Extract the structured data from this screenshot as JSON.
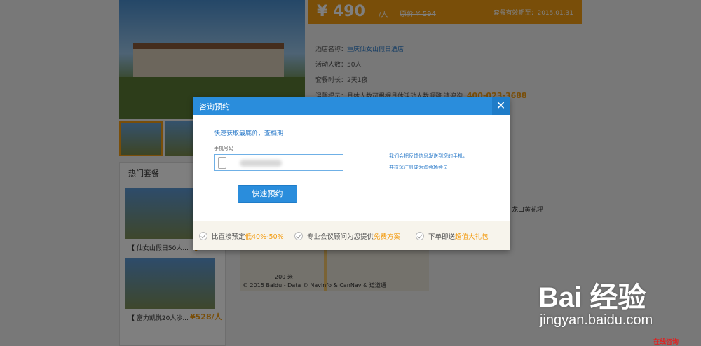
{
  "background_page": {
    "price": "¥ 490",
    "price_unit": "/人",
    "price_old": "原价 ¥ 594",
    "deadline": "套餐有效期至：2015.01.31",
    "info": [
      {
        "label": "酒店名称：",
        "value": "重庆仙女山假日酒店"
      },
      {
        "label": "活动人数：",
        "value": "50人"
      },
      {
        "label": "套餐时长：",
        "value": "2天1夜"
      },
      {
        "label": "温馨提示：",
        "value": "具体人数可根据具体活动人数调整,请咨询",
        "phone": "400-023-3688"
      }
    ],
    "hot_title": "热门套餐",
    "hot_items": [
      {
        "name": "【 仙女山假日50人...",
        "price": "【"
      },
      {
        "name": "【 富力凯悦20人沙...",
        "price": "¥528/人"
      }
    ],
    "right_heading": "龙口黄花坪",
    "map_scale": "200 米",
    "map_credit": "© 2015 Baidu - Data © Navinfo & CanNav & 道道通"
  },
  "modal": {
    "title": "咨询预约",
    "close": "✕",
    "subtitle": "快速获取最底价，查档期",
    "phone_label": "手机号码",
    "phone_value": "",
    "notice_line1": "我们会把反馈信息发送到您的手机，",
    "notice_line2": "并将您注册成为淘会场会员",
    "submit": "快速预约",
    "benefits": [
      {
        "text": "比直接预定",
        "highlight": "低40%-50%"
      },
      {
        "text": "专业会议顾问为您提供",
        "highlight": "免费方案"
      },
      {
        "text": "下单即送",
        "highlight": "超值大礼包"
      }
    ]
  },
  "watermark": {
    "logo": "Bai 经验",
    "url": "jingyan.baidu.com"
  },
  "online_chat": "在线咨询",
  "colors": {
    "accent_blue": "#2a8ddc",
    "accent_orange": "#f39c12"
  }
}
